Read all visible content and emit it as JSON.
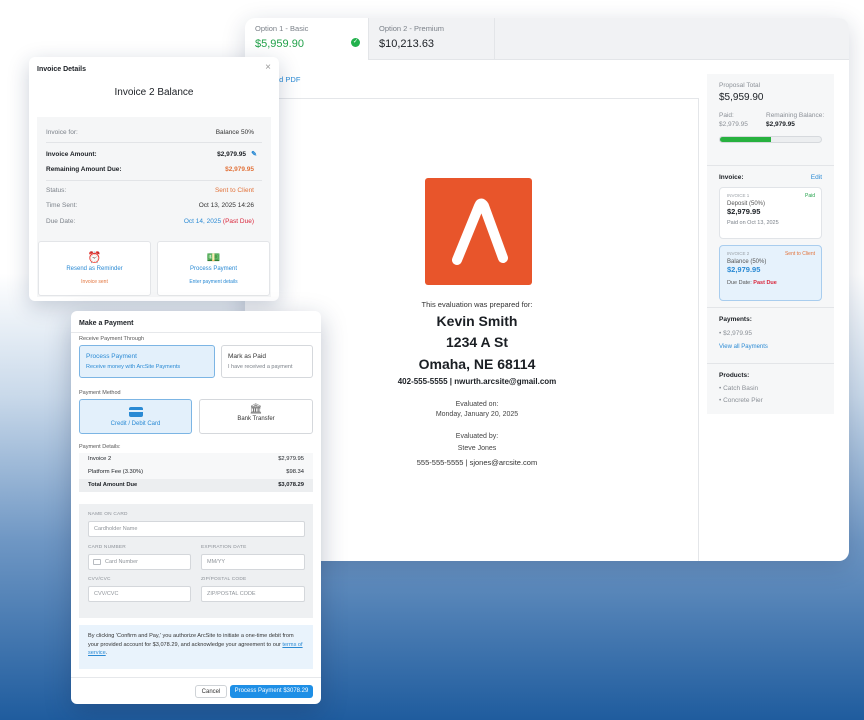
{
  "proposal": {
    "tabs": [
      {
        "label": "Option 1 - Basic",
        "price": "$5,959.90"
      },
      {
        "label": "Option 2 - Premium",
        "price": "$10,213.63"
      }
    ],
    "download_link": "ad PDF",
    "document": {
      "prepared_for_label": "This evaluation was prepared for:",
      "client_name": "Kevin Smith",
      "address_line1": "1234 A St",
      "address_line2": "Omaha, NE 68114",
      "client_contact": "402-555-5555 | nwurth.arcsite@gmail.com",
      "evaluated_on_label": "Evaluated on:",
      "evaluated_on_date": "Monday, January 20, 2025",
      "evaluated_by_label": "Evaluated by:",
      "evaluator_name": "Steve Jones",
      "evaluator_contact": "555-555-5555 |  sjones@arcsite.com"
    },
    "side": {
      "total_label": "Proposal Total",
      "total_value": "$5,959.90",
      "paid_label": "Paid:",
      "paid_value": "$2,979.95",
      "remaining_label": "Remaining Balance:",
      "remaining_value": "$2,979.95",
      "progress_fraction": 0.5,
      "invoice_label": "Invoice:",
      "edit_label": "Edit",
      "invoices": [
        {
          "tag": "INVOICE 1",
          "status": "Paid",
          "title": "Deposit (50%)",
          "amount": "$2,979.95",
          "note": "Paid on Oct 13, 2025"
        },
        {
          "tag": "INVOICE 2",
          "status": "Sent to Client",
          "title": "Balance (50%)",
          "amount": "$2,979.95",
          "due_label": "Due Date:",
          "due_value": "Past Due"
        }
      ],
      "payments_label": "Payments:",
      "payment_item": "$2,979.95",
      "view_all_payments": "View all Payments",
      "products_label": "Products:",
      "products": [
        "Catch Basin",
        "Concrete Pier"
      ]
    }
  },
  "invoice_modal": {
    "header": "Invoice Details",
    "title": "Invoice 2 Balance",
    "rows": {
      "invoice_for_label": "Invoice for:",
      "invoice_for_value": "Balance 50%",
      "amount_label": "Invoice Amount:",
      "amount_value": "$2,979.95",
      "remaining_label": "Remaining Amount Due:",
      "remaining_value": "$2,979.95",
      "status_label": "Status:",
      "status_value": "Sent to Client",
      "time_sent_label": "Time Sent:",
      "time_sent_value": "Oct 13, 2025 14:26",
      "due_label": "Due Date:",
      "due_value": "Oct 14, 2025",
      "due_flag": "(Past Due)"
    },
    "actions": [
      {
        "label": "Resend as Reminder",
        "sub": "Invoice sent"
      },
      {
        "label": "Process Payment",
        "sub": "Enter payment details"
      }
    ]
  },
  "payment_modal": {
    "title": "Make a Payment",
    "receive_label": "Receive Payment Through",
    "receive_options": [
      {
        "title": "Process Payment",
        "sub": "Receive money with ArcSite Payments"
      },
      {
        "title": "Mark as Paid",
        "sub": "I have received a payment"
      }
    ],
    "method_label": "Payment Method",
    "methods": [
      "Credit / Debit Card",
      "Bank Transfer"
    ],
    "details_label": "Payment Details:",
    "details": [
      {
        "label": "Invoice 2",
        "value": "$2,979.95"
      },
      {
        "label": "Platform Fee (3.30%)",
        "value": "$98.34"
      },
      {
        "label": "Total Amount Due",
        "value": "$3,078.29"
      }
    ],
    "card": {
      "name_label": "NAME ON CARD",
      "name_placeholder": "Cardholder Name",
      "number_label": "CARD NUMBER",
      "number_placeholder": "Card Number",
      "exp_label": "EXPIRATION DATE",
      "exp_placeholder": "MM/YY",
      "cvv_label": "CVV/CVC",
      "cvv_placeholder": "CVV/CVC",
      "zip_label": "ZIP/POSTAL CODE",
      "zip_placeholder": "ZIP/POSTAL CODE"
    },
    "consent_text": "By clicking 'Confirm and Pay,' you authorize ArcSite to initiate a one-time debit from your provided account for $3,078.29, and acknowledge your agreement to our",
    "terms_link": "terms of service",
    "cancel_label": "Cancel",
    "submit_label": "Process Payment $3078.29"
  },
  "colors": {
    "accent_blue": "#2a8ad4",
    "brand_orange": "#e8552b",
    "paid_green": "#22b14c",
    "status_orange": "#e2733b",
    "past_due_red": "#d9263b"
  }
}
